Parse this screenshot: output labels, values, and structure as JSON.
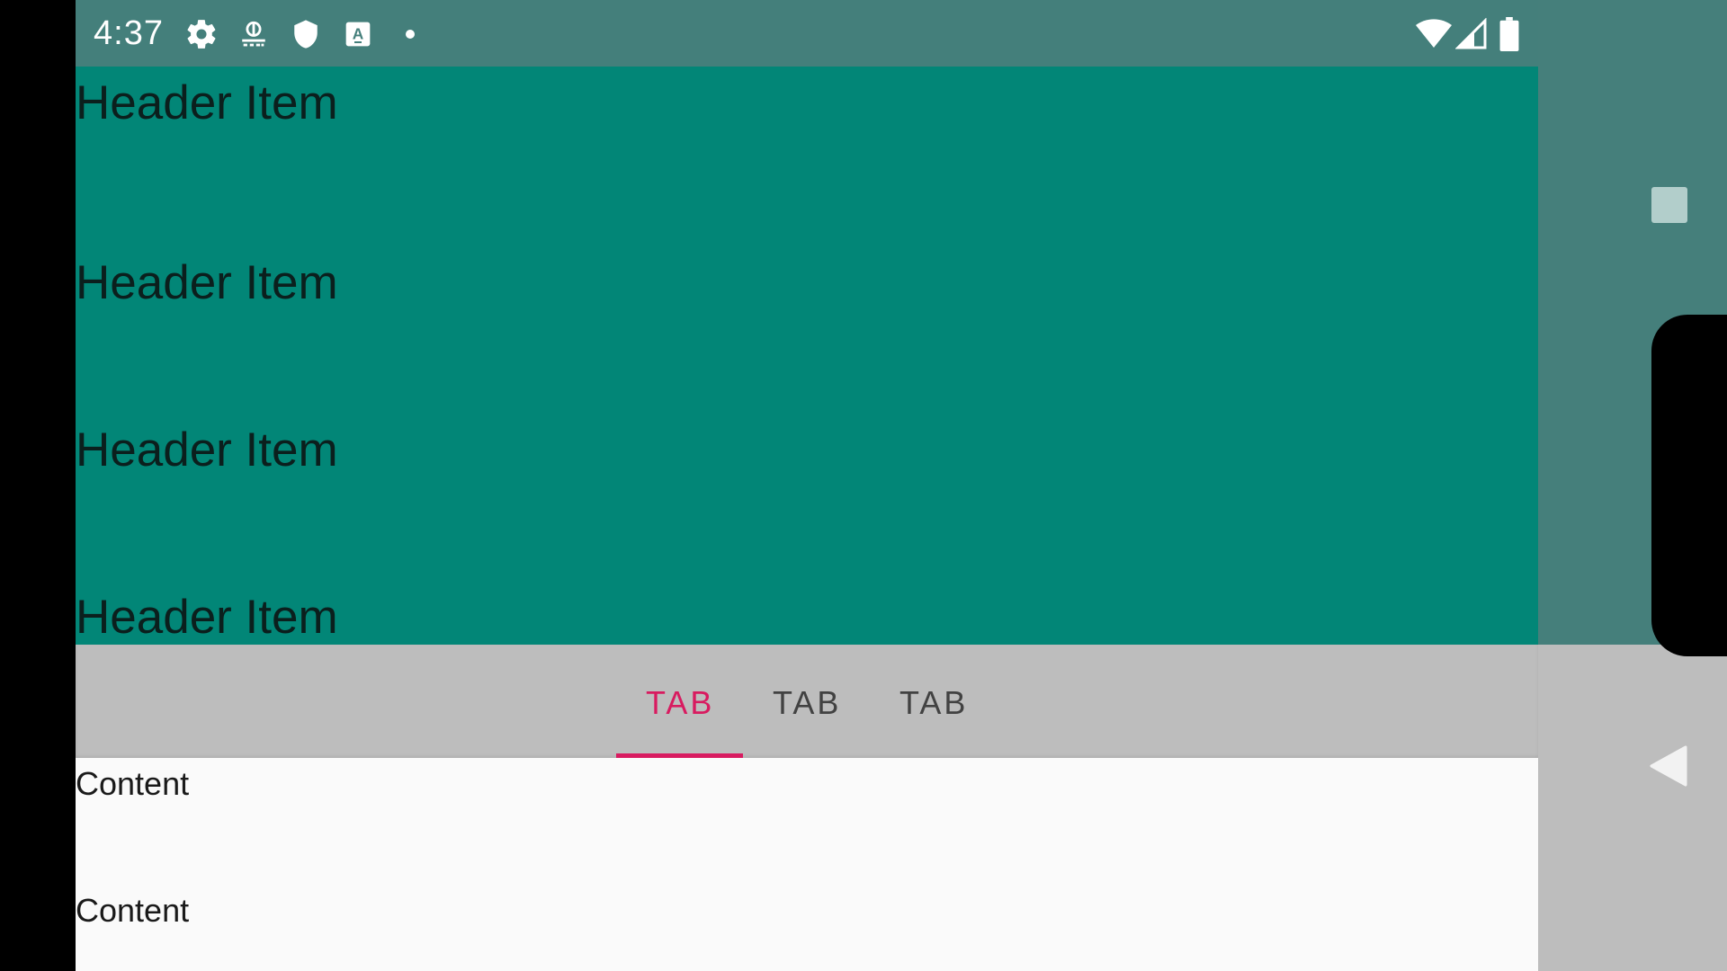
{
  "status_bar": {
    "time": "4:37",
    "left_icons": [
      "gear-icon",
      "app-notification-icon",
      "shield-icon",
      "keyboard-a-icon",
      "dot-icon"
    ],
    "right_icons": [
      "wifi-icon",
      "cellular-signal-icon",
      "battery-icon"
    ]
  },
  "header": {
    "items": [
      "Header Item",
      "Header Item",
      "Header Item",
      "Header Item"
    ]
  },
  "tabs": {
    "items": [
      {
        "label": "TAB",
        "selected": true
      },
      {
        "label": "TAB",
        "selected": false
      },
      {
        "label": "TAB",
        "selected": false
      }
    ],
    "selected_color": "#d81b60",
    "unselected_color": "#424242"
  },
  "content": {
    "items": [
      "Content",
      "Content"
    ]
  },
  "navigation": {
    "buttons": [
      "recents-square-icon",
      "home-circle-icon",
      "back-triangle-icon"
    ]
  },
  "colors": {
    "header_bg": "#028677",
    "status_bg": "#447f7b",
    "tab_bar_bg": "#bdbdbd",
    "content_bg": "#fafafa"
  }
}
